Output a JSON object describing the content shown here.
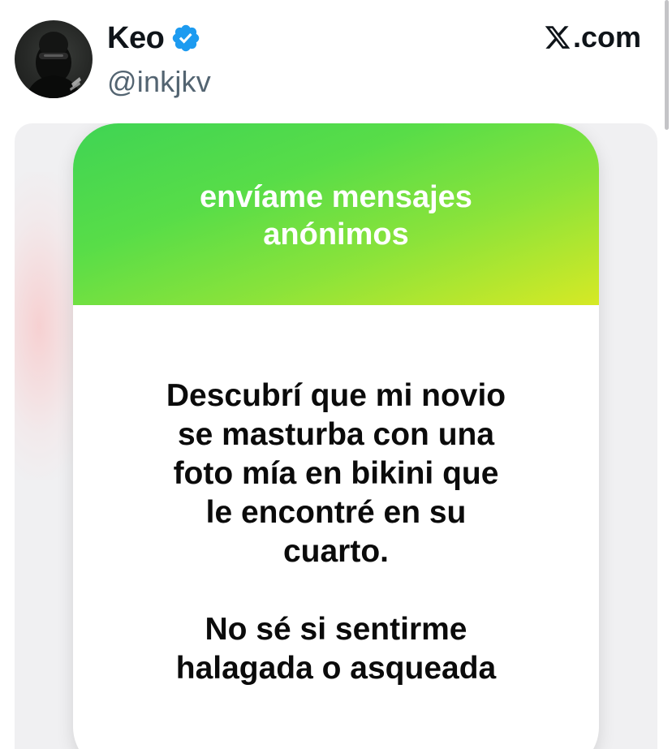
{
  "post": {
    "author": {
      "display_name": "Keo",
      "handle": "@inkjkv",
      "verified_icon": "verified-badge-icon",
      "verified_color": "#1d9bf0",
      "avatar_icon": "masked-person-avatar"
    },
    "source": {
      "logo_icon": "x-logo-icon",
      "label": ".com"
    }
  },
  "media": {
    "card": {
      "title": "envíame mensajes\nanónimos",
      "message": "Descubrí que mi novio\nse masturba con una\nfoto mía en bikini que\nle encontré en su\ncuarto.\n\nNo sé si sentirme\nhalagada o asqueada",
      "gradient_colors": [
        "#3fd454",
        "#8be33a",
        "#d6e925"
      ]
    }
  }
}
